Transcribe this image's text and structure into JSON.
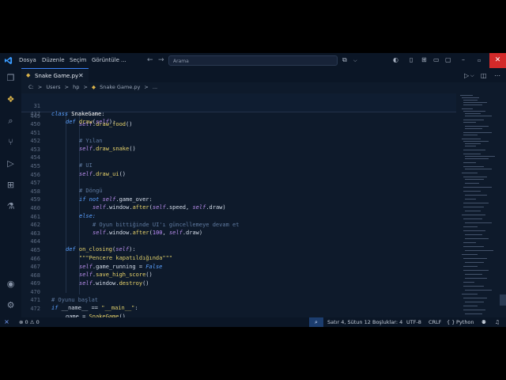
{
  "titlebar": {
    "menu": [
      "Dosya",
      "Düzenle",
      "Seçim",
      "Görüntüle",
      "..."
    ],
    "search_placeholder": "Arama",
    "close_glyph": "✕"
  },
  "activity_bar": {
    "items": [
      "explorer-icon",
      "python-icon",
      "search-icon",
      "source-control-icon",
      "run-debug-icon",
      "extensions-icon",
      "testing-icon"
    ],
    "bottom": [
      "account-icon",
      "settings-icon"
    ]
  },
  "tabs": [
    {
      "label": "Snake Game.py",
      "active": true
    }
  ],
  "breadcrumb": [
    "C:",
    ">",
    "Users",
    ">",
    "hp",
    ">",
    "Snake Game.py",
    ">",
    "..."
  ],
  "sticky_lines": [
    {
      "num": "31",
      "code": "class SnakeGame:"
    },
    {
      "num": "437",
      "code": "def draw(self):"
    }
  ],
  "lines": [
    {
      "num": "449",
      "code": "self.draw_food()"
    },
    {
      "num": "450",
      "code": ""
    },
    {
      "num": "451",
      "code": "# Yılan"
    },
    {
      "num": "452",
      "code": "self.draw_snake()"
    },
    {
      "num": "453",
      "code": ""
    },
    {
      "num": "454",
      "code": "# UI"
    },
    {
      "num": "455",
      "code": "self.draw_ui()"
    },
    {
      "num": "456",
      "code": ""
    },
    {
      "num": "457",
      "code": "# Döngü"
    },
    {
      "num": "458",
      "code": "if not self.game_over:"
    },
    {
      "num": "459",
      "code": "self.window.after(self.speed, self.draw)"
    },
    {
      "num": "460",
      "code": "else:"
    },
    {
      "num": "461",
      "code": "# Oyun bittiğinde UI'ı güncellemeye devam et"
    },
    {
      "num": "462",
      "code": "self.window.after(100, self.draw)"
    },
    {
      "num": "463",
      "code": ""
    },
    {
      "num": "464",
      "code": "def on_closing(self):"
    },
    {
      "num": "465",
      "code": "\"\"\"Pencere kapatıldığında\"\"\""
    },
    {
      "num": "466",
      "code": "self.game_running = False"
    },
    {
      "num": "467",
      "code": "self.save_high_score()"
    },
    {
      "num": "468",
      "code": "self.window.destroy()"
    },
    {
      "num": "469",
      "code": ""
    },
    {
      "num": "470",
      "code": "# Oyunu başlat"
    },
    {
      "num": "471",
      "code": "if __name__ == \"__main__\":"
    },
    {
      "num": "472",
      "code": "game = SnakeGame()"
    }
  ],
  "status": {
    "problems": "0",
    "warnings": "0",
    "position": "Satır 4, Sütun 12",
    "spaces": "Boşluklar: 4",
    "encoding": "UTF-8",
    "eol": "CRLF",
    "language": "Python",
    "language_icon": "{ }"
  },
  "colors": {
    "accent": "#3b82f6",
    "close": "#d32a2a",
    "background": "#0e1a2b"
  }
}
